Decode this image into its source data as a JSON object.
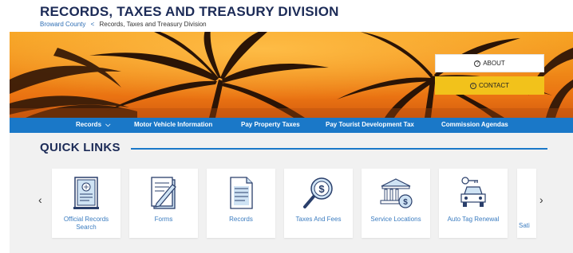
{
  "header": {
    "title": "RECORDS, TAXES AND TREASURY DIVISION",
    "breadcrumb": {
      "home": "Broward County",
      "separator": "<",
      "current": "Records, Taxes and Treasury Division"
    }
  },
  "hero": {
    "about_label": "ABOUT",
    "about_icon": "?",
    "contact_label": "CONTACT",
    "contact_icon": "i"
  },
  "nav": {
    "items": [
      {
        "label": "Records",
        "has_dropdown": true
      },
      {
        "label": "Motor Vehicle Information"
      },
      {
        "label": "Pay Property Taxes"
      },
      {
        "label": "Pay Tourist Development Tax"
      },
      {
        "label": "Commission Agendas"
      }
    ],
    "dropdown_glyph": "⌵"
  },
  "quick_links": {
    "title": "QUICK LINKS",
    "prev_arrow": "‹",
    "next_arrow": "›",
    "cards": [
      {
        "label": "Official Records Search",
        "icon": "document-seal-icon"
      },
      {
        "label": "Forms",
        "icon": "forms-pen-icon"
      },
      {
        "label": "Records",
        "icon": "records-doc-icon"
      },
      {
        "label": "Taxes And Fees",
        "icon": "dollar-magnifier-icon"
      },
      {
        "label": "Service Locations",
        "icon": "bank-building-icon"
      },
      {
        "label": "Auto Tag Renewal",
        "icon": "car-key-icon"
      },
      {
        "label": "Sati",
        "icon": ""
      }
    ]
  },
  "colors": {
    "navy": "#1c2b57",
    "blue": "#1a78c8",
    "link": "#3b7cc0",
    "contact_yellow": "#f2c21b"
  }
}
